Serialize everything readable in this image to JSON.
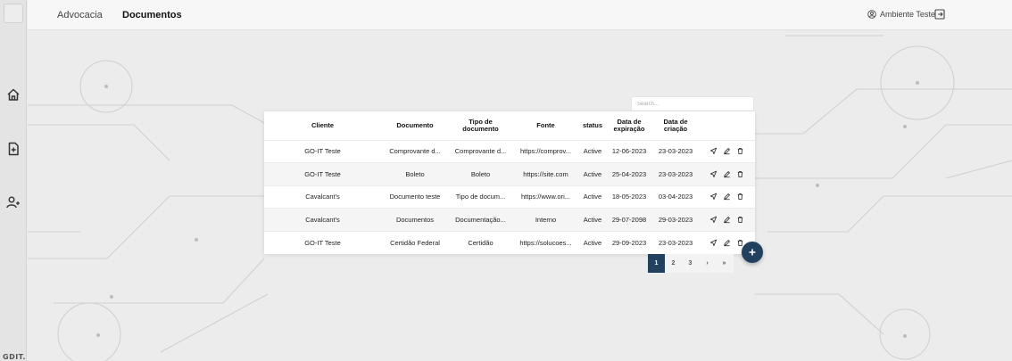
{
  "topbar": {
    "breadcrumb_1": "Advocacia",
    "breadcrumb_2": "Documentos",
    "user_name": "Ambiente Teste"
  },
  "sidebar": {
    "items": [
      {
        "icon": "home-icon"
      },
      {
        "icon": "document-add-icon"
      },
      {
        "icon": "user-add-icon"
      }
    ],
    "brand": "GDIT."
  },
  "search": {
    "placeholder": "Search..."
  },
  "table": {
    "headers": [
      "Cliente",
      "Documento",
      "Tipo de documento",
      "Fonte",
      "status",
      "Data de expiração",
      "Data de criação"
    ],
    "rows": [
      [
        "GO-IT Teste",
        "Comprovante d...",
        "Comprovante d...",
        "https://comprov...",
        "Active",
        "12-06-2023",
        "23-03-2023"
      ],
      [
        "GO-IT Teste",
        "Boleto",
        "Boleto",
        "https://site.com",
        "Active",
        "25-04-2023",
        "23-03-2023"
      ],
      [
        "Cavalcant's",
        "Documento teste",
        "Tipo de docum...",
        "https://www.ori...",
        "Active",
        "18-05-2023",
        "03-04-2023"
      ],
      [
        "Cavalcant's",
        "Documentos",
        "Documentação...",
        "Interno",
        "Active",
        "29-07-2098",
        "29-03-2023"
      ],
      [
        "GO-IT Teste",
        "Certidão Federal",
        "Certidão",
        "https://solucoes...",
        "Active",
        "29-09-2023",
        "23-03-2023"
      ]
    ],
    "row_actions": [
      "send-icon",
      "edit-icon",
      "delete-icon"
    ]
  },
  "pagination": {
    "pages": [
      "1",
      "2",
      "3"
    ],
    "next": "›",
    "last": "»",
    "current": "1"
  },
  "colors": {
    "accent": "#22415f",
    "background": "#ececec"
  }
}
